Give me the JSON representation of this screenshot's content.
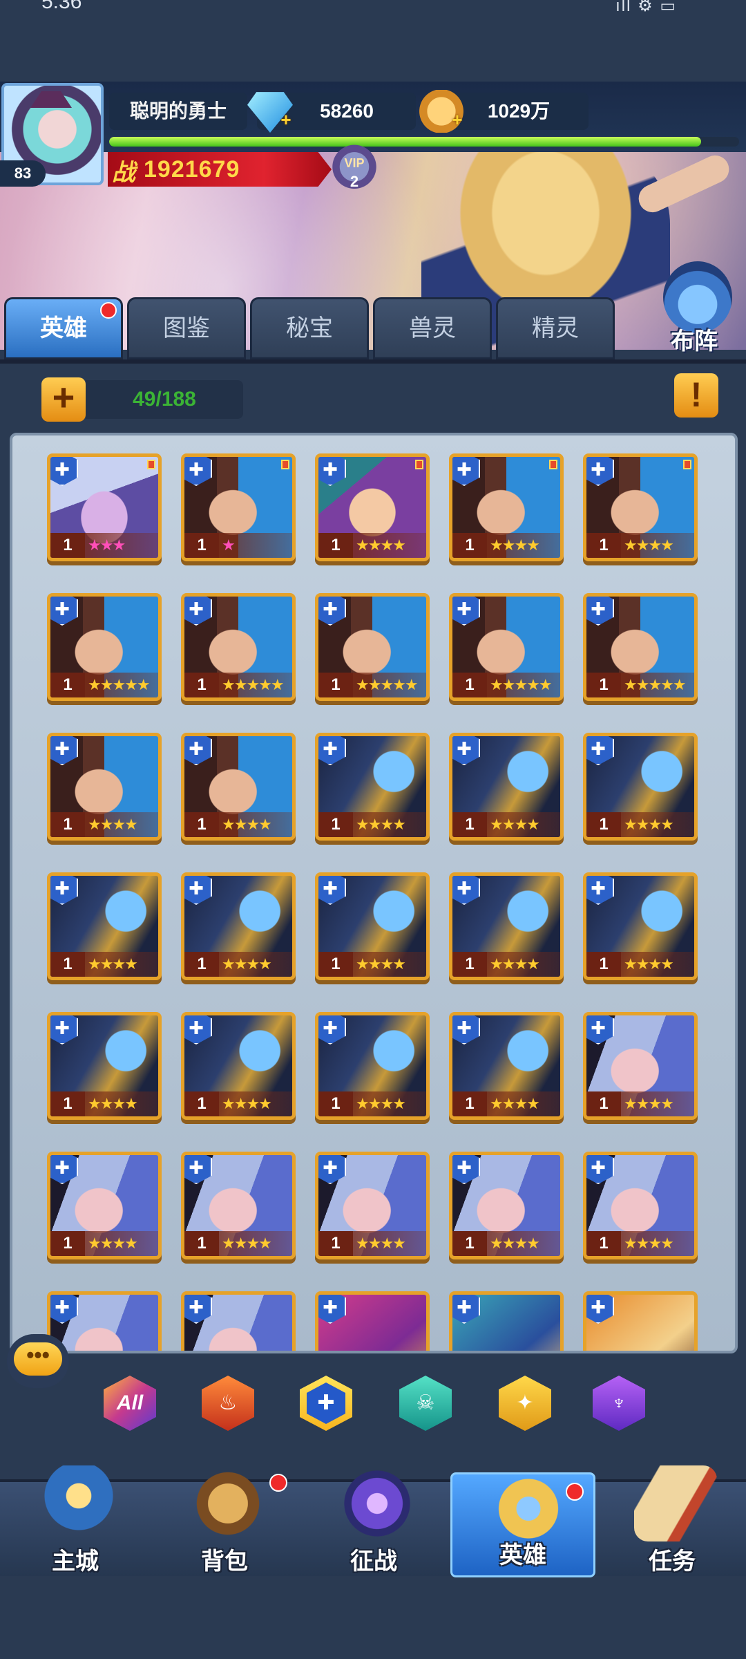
{
  "status": {
    "time": "5:36",
    "signal": "ıll ⚙ ▭"
  },
  "player": {
    "name": "聪明的勇士",
    "level": "83",
    "gems": "58260",
    "coins": "1029万",
    "power_prefix": "战",
    "power": "1921679",
    "vip_label": "VIP",
    "vip_level": "2",
    "exp_fraction": 0.94
  },
  "tabs": [
    {
      "label": "英雄",
      "active": true,
      "has_dot": true
    },
    {
      "label": "图鉴"
    },
    {
      "label": "秘宝"
    },
    {
      "label": "兽灵"
    },
    {
      "label": "精灵"
    }
  ],
  "formation_label": "布阵",
  "toolbar": {
    "plus": "+",
    "count": "49/188",
    "info": "!"
  },
  "cards": [
    {
      "portrait": "mage",
      "level": "1",
      "stars": "★★★",
      "star_color": "pink",
      "badge": true
    },
    {
      "portrait": "man",
      "level": "1",
      "stars": "★",
      "star_color": "pink",
      "badge": true
    },
    {
      "portrait": "goggle",
      "level": "1",
      "stars": "★★★★",
      "badge": true
    },
    {
      "portrait": "man",
      "level": "1",
      "stars": "★★★★",
      "badge": true
    },
    {
      "portrait": "man",
      "level": "1",
      "stars": "★★★★",
      "badge": true
    },
    {
      "portrait": "man",
      "level": "1",
      "stars": "★★★★★"
    },
    {
      "portrait": "man",
      "level": "1",
      "stars": "★★★★★"
    },
    {
      "portrait": "man",
      "level": "1",
      "stars": "★★★★★"
    },
    {
      "portrait": "man",
      "level": "1",
      "stars": "★★★★★"
    },
    {
      "portrait": "man",
      "level": "1",
      "stars": "★★★★★"
    },
    {
      "portrait": "man",
      "level": "1",
      "stars": "★★★★"
    },
    {
      "portrait": "man",
      "level": "1",
      "stars": "★★★★"
    },
    {
      "portrait": "knight",
      "level": "1",
      "stars": "★★★★"
    },
    {
      "portrait": "knight",
      "level": "1",
      "stars": "★★★★"
    },
    {
      "portrait": "knight",
      "level": "1",
      "stars": "★★★★"
    },
    {
      "portrait": "knight",
      "level": "1",
      "stars": "★★★★"
    },
    {
      "portrait": "knight",
      "level": "1",
      "stars": "★★★★"
    },
    {
      "portrait": "knight",
      "level": "1",
      "stars": "★★★★"
    },
    {
      "portrait": "knight",
      "level": "1",
      "stars": "★★★★"
    },
    {
      "portrait": "knight",
      "level": "1",
      "stars": "★★★★"
    },
    {
      "portrait": "knight",
      "level": "1",
      "stars": "★★★★"
    },
    {
      "portrait": "knight",
      "level": "1",
      "stars": "★★★★"
    },
    {
      "portrait": "knight",
      "level": "1",
      "stars": "★★★★"
    },
    {
      "portrait": "knight",
      "level": "1",
      "stars": "★★★★"
    },
    {
      "portrait": "white",
      "level": "1",
      "stars": "★★★★"
    },
    {
      "portrait": "white",
      "level": "1",
      "stars": "★★★★"
    },
    {
      "portrait": "white",
      "level": "1",
      "stars": "★★★★"
    },
    {
      "portrait": "white",
      "level": "1",
      "stars": "★★★★"
    },
    {
      "portrait": "white",
      "level": "1",
      "stars": "★★★★"
    },
    {
      "portrait": "white",
      "level": "1",
      "stars": "★★★★"
    },
    {
      "portrait": "white",
      "level": "",
      "stars": ""
    },
    {
      "portrait": "white",
      "level": "",
      "stars": ""
    },
    {
      "portrait": "pink",
      "level": "",
      "stars": ""
    },
    {
      "portrait": "teal",
      "level": "",
      "stars": ""
    },
    {
      "portrait": "orange",
      "level": "",
      "stars": ""
    }
  ],
  "class_icon": "✚",
  "chat_icon": "•••",
  "filters": [
    {
      "key": "all",
      "label": "All",
      "icon": "all-filter-icon"
    },
    {
      "key": "fire",
      "label": "♨",
      "icon": "fire-filter-icon"
    },
    {
      "key": "water",
      "label": "✚",
      "icon": "water-filter-icon",
      "selected": true
    },
    {
      "key": "skull",
      "label": "☠",
      "icon": "skull-filter-icon"
    },
    {
      "key": "light",
      "label": "✦",
      "icon": "light-filter-icon"
    },
    {
      "key": "dark",
      "label": "♆",
      "icon": "dark-filter-icon"
    }
  ],
  "nav": [
    {
      "label": "主城",
      "art": "castle"
    },
    {
      "label": "背包",
      "art": "bag",
      "has_dot": true
    },
    {
      "label": "征战",
      "art": "battle"
    },
    {
      "label": "英雄",
      "art": "hero",
      "active": true,
      "has_dot": true
    },
    {
      "label": "任务",
      "art": "quest"
    }
  ]
}
